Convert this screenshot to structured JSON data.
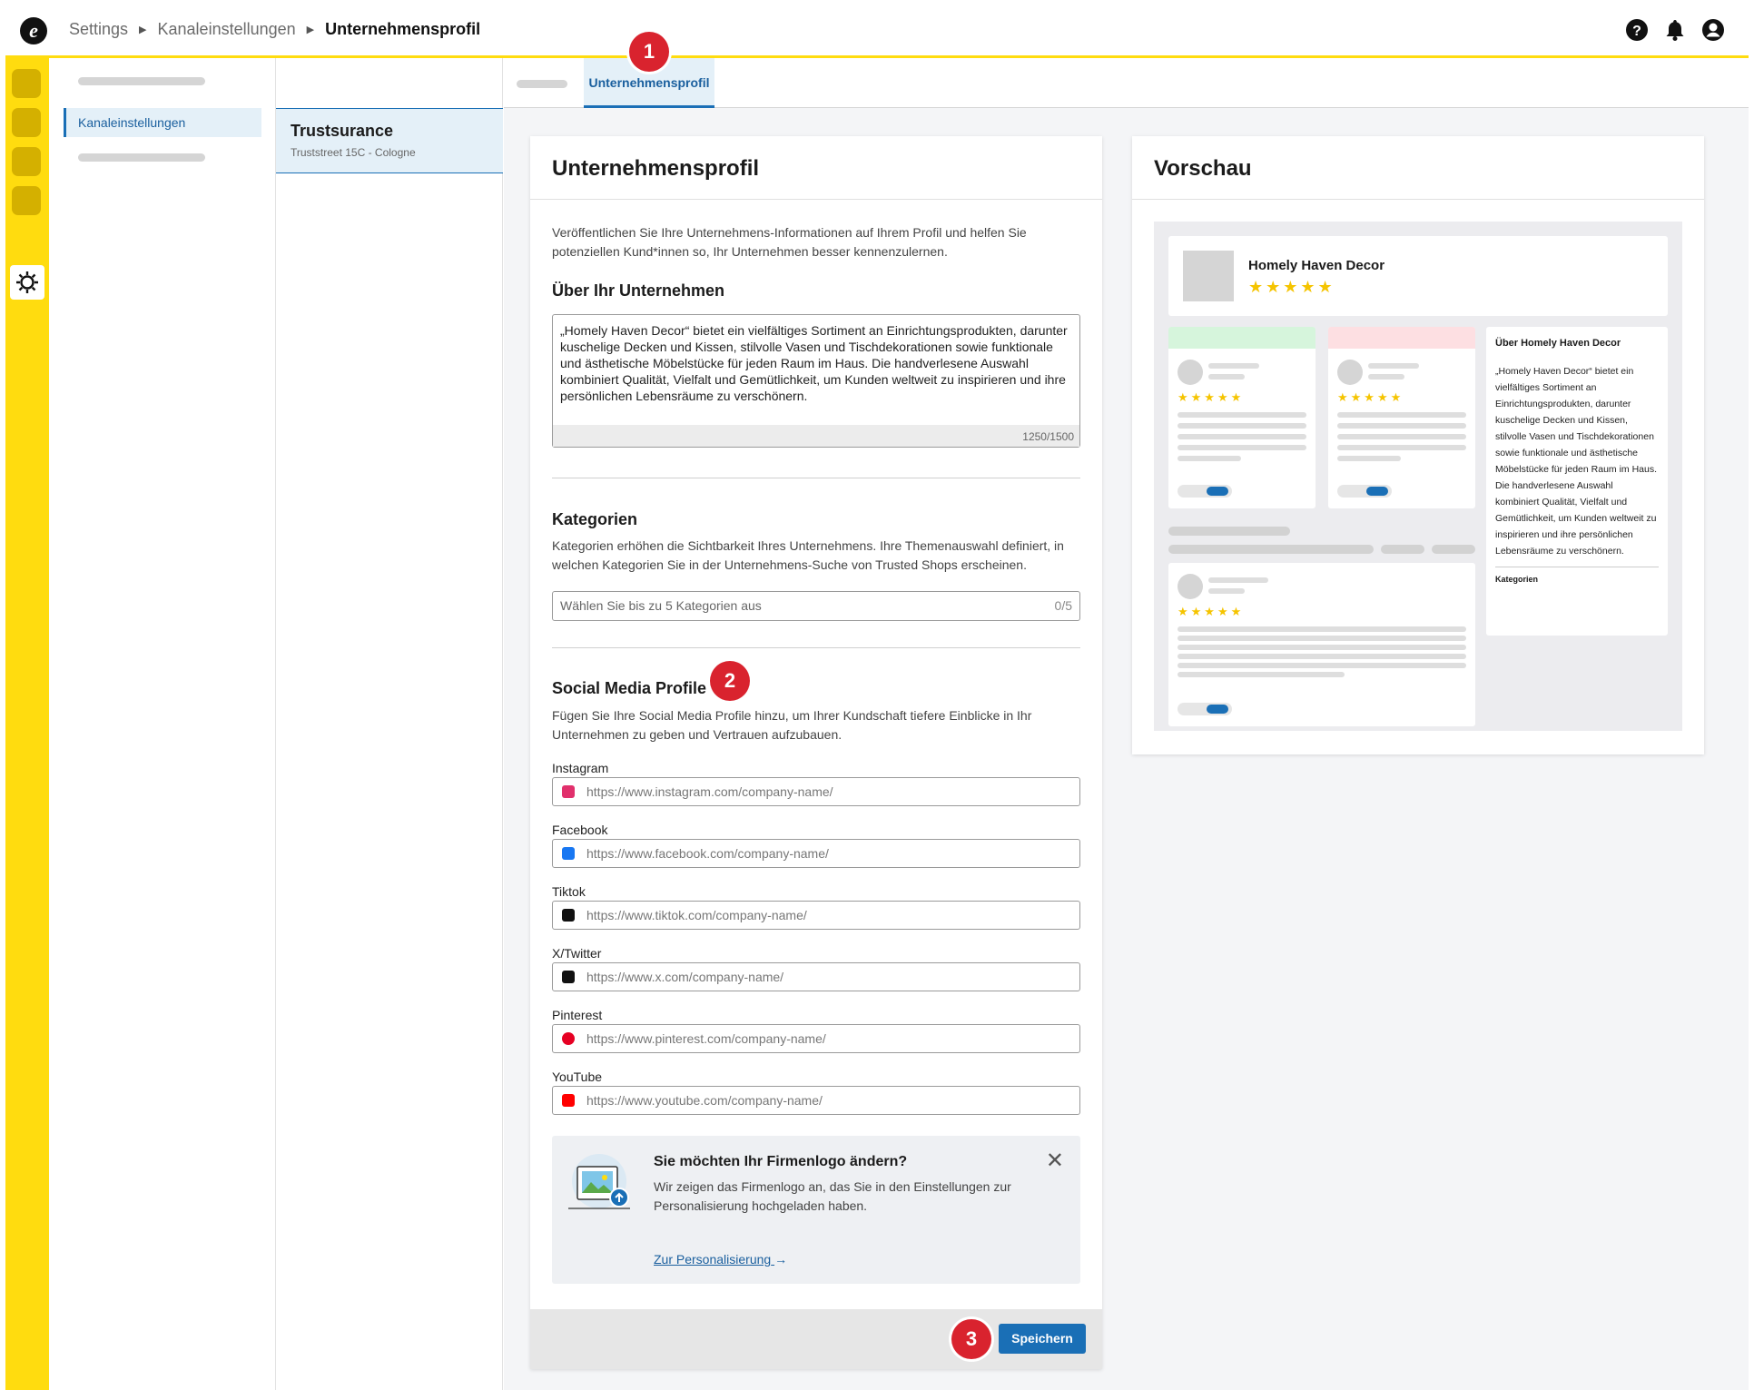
{
  "breadcrumb": {
    "items": [
      "Settings",
      "Kanaleinstellungen"
    ],
    "current": "Unternehmensprofil"
  },
  "nav": {
    "active_item": "Kanaleinstellungen"
  },
  "channel": {
    "name": "Trustsurance",
    "address": "Truststreet 15C - Cologne"
  },
  "tabs": {
    "active": "Unternehmensprofil"
  },
  "badges": [
    "1",
    "2",
    "3"
  ],
  "form": {
    "title": "Unternehmensprofil",
    "intro": "Veröffentlichen Sie Ihre Unternehmens-Informationen auf Ihrem Profil und helfen Sie potenziellen Kund*innen so, Ihr Unternehmen besser kennenzulernen.",
    "about_heading": "Über Ihr Unternehmen",
    "about_text": "„Homely Haven Decor“ bietet ein vielfältiges Sortiment an Einrichtungsprodukten, darunter kuschelige Decken und Kissen, stilvolle Vasen und Tischdekorationen sowie funktionale und ästhetische Möbelstücke für jeden Raum im Haus. Die handverlesene Auswahl kombiniert Qualität, Vielfalt und Gemütlichkeit, um Kunden weltweit zu inspirieren und ihre persönlichen Lebensräume zu verschönern.",
    "about_count": "1250/1500",
    "categories_heading": "Kategorien",
    "categories_desc": "Kategorien erhöhen die Sichtbarkeit Ihres Unternehmens. Ihre Themenauswahl definiert, in welchen Kategorien Sie in der Unternehmens-Suche von Trusted Shops erscheinen.",
    "categories_placeholder": "Wählen Sie bis zu 5 Kategorien aus",
    "categories_count": "0/5",
    "social_heading": "Social Media Profile",
    "social_desc": "Fügen Sie Ihre Social Media Profile hinzu, um Ihrer Kundschaft tiefere Einblicke in Ihr Unternehmen zu geben und Vertrauen aufzubauen.",
    "social": [
      {
        "label": "Instagram",
        "placeholder": "https://www.instagram.com/company-name/",
        "icon": "instagram-icon",
        "color": "#e1306c"
      },
      {
        "label": "Facebook",
        "placeholder": "https://www.facebook.com/company-name/",
        "icon": "facebook-icon",
        "color": "#1877f2"
      },
      {
        "label": "Tiktok",
        "placeholder": "https://www.tiktok.com/company-name/",
        "icon": "tiktok-icon",
        "color": "#111111"
      },
      {
        "label": "X/Twitter",
        "placeholder": "https://www.x.com/company-name/",
        "icon": "x-icon",
        "color": "#111111"
      },
      {
        "label": "Pinterest",
        "placeholder": "https://www.pinterest.com/company-name/",
        "icon": "pinterest-icon",
        "color": "#e60023"
      },
      {
        "label": "YouTube",
        "placeholder": "https://www.youtube.com/company-name/",
        "icon": "youtube-icon",
        "color": "#ff0000"
      }
    ],
    "notice": {
      "title": "Sie möchten Ihr Firmenlogo ändern?",
      "desc": "Wir zeigen das Firmenlogo an, das Sie in den Einstellungen zur Personalisierung hochgeladen haben.",
      "link": "Zur Personalisierung"
    },
    "save_label": "Speichern"
  },
  "preview": {
    "title": "Vorschau",
    "company": "Homely Haven Decor",
    "stars": "★★★★★",
    "about_heading": "Über Homely Haven Decor",
    "about_text": "„Homely Haven Decor“ bietet ein vielfältiges Sortiment an Einrichtungsprodukten, darunter kuschelige Decken und Kissen, stilvolle Vasen und Tischdekorationen sowie funktionale und ästhetische Möbelstücke für jeden Raum im Haus. Die handverlesene Auswahl kombiniert Qualität, Vielfalt und Gemütlichkeit, um Kunden weltweit zu inspirieren und ihre persönlichen Lebensräume zu verschönern.",
    "categories_label": "Kategorien"
  },
  "colors": {
    "accent": "#1a6fb6",
    "rail": "#ffdc0f",
    "badge": "#d9232e"
  }
}
